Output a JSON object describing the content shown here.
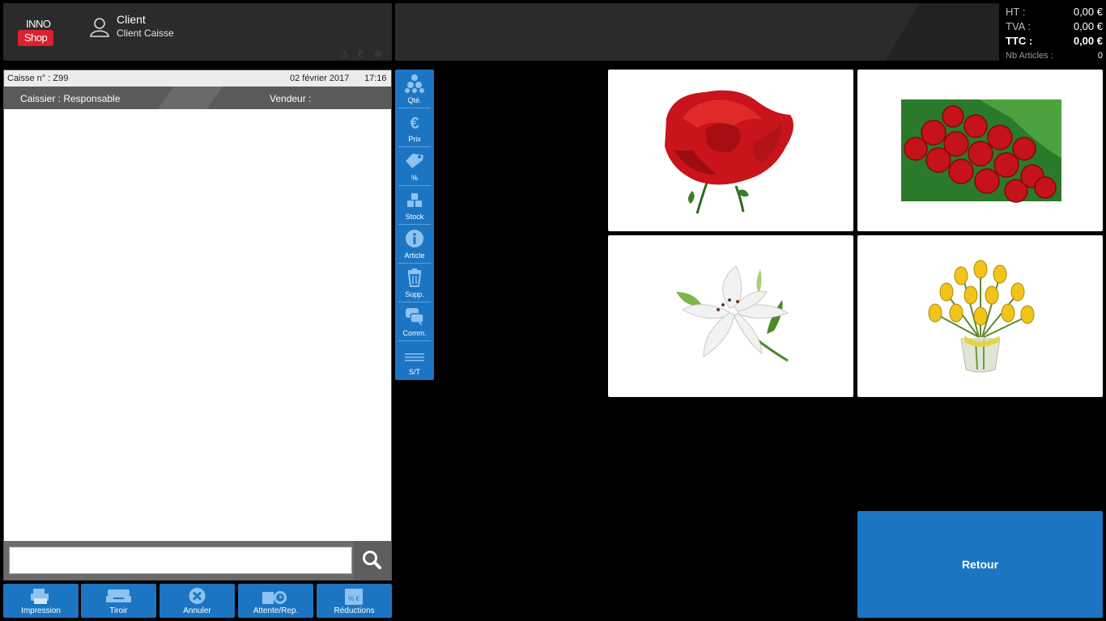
{
  "brand": {
    "line1": "INNO",
    "line2": "Shop"
  },
  "client": {
    "title": "Client",
    "subtitle": "Client Caisse"
  },
  "status_icons": [
    "warning-icon",
    "euro-icon",
    "gear-icon"
  ],
  "totals": {
    "ht_label": "HT :",
    "ht_value": "0,00 €",
    "tva_label": "TVA :",
    "tva_value": "0,00 €",
    "ttc_label": "TTC :",
    "ttc_value": "0,00 €",
    "nb_label": "Nb Articles :",
    "nb_value": "0"
  },
  "ticket": {
    "caisse": "Caisse n° : Z99",
    "date": "02 février 2017",
    "time": "17:16",
    "caissier": "Caissier : Responsable",
    "vendeur": "Vendeur :"
  },
  "search": {
    "value": "",
    "icon": "search-icon"
  },
  "toolbar": [
    {
      "label": "Qté.",
      "icon": "quantity-icon"
    },
    {
      "label": "Prix",
      "icon": "euro-icon"
    },
    {
      "label": "%",
      "icon": "tag-icon"
    },
    {
      "label": "Stock",
      "icon": "stock-icon"
    },
    {
      "label": "Article",
      "icon": "info-icon"
    },
    {
      "label": "Supp.",
      "icon": "trash-icon"
    },
    {
      "label": "Comm.",
      "icon": "comment-icon"
    },
    {
      "label": "S/T",
      "icon": "subtotal-icon"
    }
  ],
  "bottom_buttons": [
    {
      "label": "Impression",
      "icon": "print-icon"
    },
    {
      "label": "Tiroir",
      "icon": "drawer-icon"
    },
    {
      "label": "Annuler",
      "icon": "cancel-icon"
    },
    {
      "label": "Attente/Rep.",
      "icon": "wait-icon"
    },
    {
      "label": "Réductions",
      "icon": "discount-icon"
    }
  ],
  "products": [
    {
      "image": "red-rose-icon"
    },
    {
      "image": "rose-bouquet-icon"
    },
    {
      "image": "white-lily-icon"
    },
    {
      "image": "yellow-tulips-icon"
    }
  ],
  "retour_label": "Retour",
  "colors": {
    "accent": "#1c75c2",
    "header": "#2b2b2b",
    "brand_red": "#d9212f"
  }
}
